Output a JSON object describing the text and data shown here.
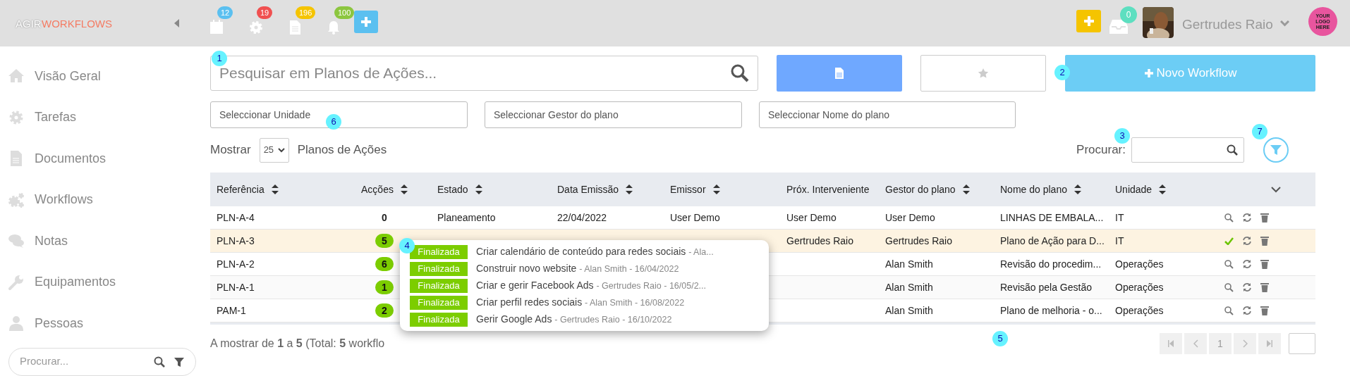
{
  "topbar": {
    "brand": "AGIR",
    "module": "WORKFLOWS",
    "notification_badges": [
      {
        "count": "12",
        "color": "#5bc0f0"
      },
      {
        "count": "19",
        "color": "#f05050"
      },
      {
        "count": "196",
        "color": "#f5c400"
      },
      {
        "count": "100",
        "color": "#8cc63f"
      }
    ],
    "inbox_badge": "0",
    "user_name": "Gertrudes Raio",
    "logo_text": "YOUR LOGO HERE"
  },
  "sidebar": {
    "items": [
      {
        "label": "Visão Geral"
      },
      {
        "label": "Tarefas"
      },
      {
        "label": "Documentos"
      },
      {
        "label": "Workflows"
      },
      {
        "label": "Notas"
      },
      {
        "label": "Equipamentos"
      },
      {
        "label": "Pessoas"
      }
    ],
    "search": {
      "placeholder": "Procurar..."
    }
  },
  "search": {
    "placeholder": "Pesquisar em Planos de Ações..."
  },
  "new_button": "Novo Workflow",
  "filters": [
    {
      "placeholder": "Seleccionar Unidade"
    },
    {
      "placeholder": "Seleccionar Gestor do plano"
    },
    {
      "placeholder": "Seleccionar Nome do plano"
    }
  ],
  "length": {
    "before": "Mostrar",
    "value": "25",
    "after": "Planos de Ações"
  },
  "table_search": {
    "label": "Procurar:"
  },
  "table": {
    "columns": [
      "Referência",
      "Acções",
      "Estado",
      "Data Emissão",
      "Emissor",
      "Próx. Interveniente",
      "Gestor do plano",
      "Nome do plano",
      "Unidade"
    ],
    "rows": [
      {
        "selected": false,
        "approved": false,
        "badge": false,
        "cells": [
          "PLN-A-4",
          "0",
          "Planeamento",
          "22/04/2022",
          "User Demo",
          "User Demo",
          "User Demo",
          "LINHAS DE EMBALA...",
          "IT"
        ]
      },
      {
        "selected": true,
        "approved": true,
        "badge": true,
        "cells": [
          "PLN-A-3",
          "5",
          null,
          null,
          null,
          "Gertrudes Raio",
          "Gertrudes Raio",
          "Plano de Ação para D...",
          "IT"
        ]
      },
      {
        "selected": false,
        "approved": false,
        "badge": true,
        "cells": [
          "PLN-A-2",
          "6",
          null,
          null,
          null,
          "",
          "Alan Smith",
          "Revisão do procedim...",
          "Operações"
        ]
      },
      {
        "selected": false,
        "approved": false,
        "badge": true,
        "cells": [
          "PLN-A-1",
          "1",
          null,
          null,
          null,
          "",
          "Alan Smith",
          "Revisão pela Gestão",
          "Operações"
        ]
      },
      {
        "selected": false,
        "approved": false,
        "badge": true,
        "cells": [
          "PAM-1",
          "2",
          null,
          null,
          null,
          "",
          "Alan Smith",
          "Plano de melhoria - o...",
          "Operações"
        ]
      }
    ]
  },
  "footer": "A mostrar de **1** a **5** (Total: **5** workflo",
  "pagination": [
    "1"
  ],
  "popup": [
    {
      "status": "Finalizada",
      "title": "Criar calendário de conteúdo para redes sociais",
      "meta": "- Ala..."
    },
    {
      "status": "Finalizada",
      "title": "Construir novo website",
      "meta": "- Alan Smith - 16/04/2022"
    },
    {
      "status": "Finalizada",
      "title": "Criar e gerir Facebook Ads",
      "meta": "- Gertrudes Raio - 16/05/2..."
    },
    {
      "status": "Finalizada",
      "title": "Criar perfil redes sociais",
      "meta": "- Alan Smith - 16/08/2022"
    },
    {
      "status": "Finalizada",
      "title": "Gerir Google Ads",
      "meta": "- Gertrudes Raio - 16/10/2022"
    }
  ],
  "markers": [
    "1",
    "2",
    "3",
    "4",
    "5",
    "6",
    "7"
  ]
}
